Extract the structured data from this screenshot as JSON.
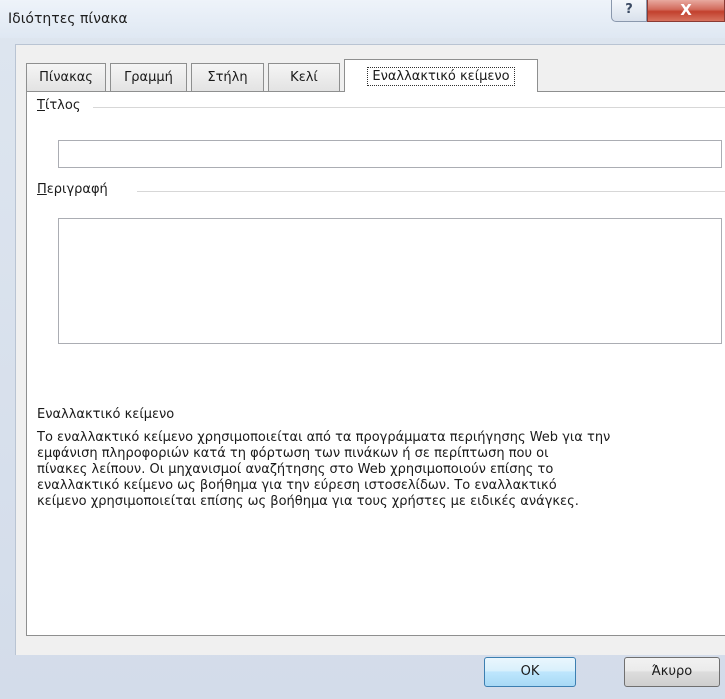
{
  "window": {
    "title": "Ιδιότητες πίνακα",
    "help_glyph": "?",
    "close_glyph": "X"
  },
  "tabs": [
    {
      "label": "Πίνακας"
    },
    {
      "label": "Γραμμή"
    },
    {
      "label": "Στήλη"
    },
    {
      "label": "Κελί"
    },
    {
      "label": "Εναλλακτικό κείμενο",
      "active": true
    }
  ],
  "form": {
    "title_label": "Τίτλος",
    "title_value": "",
    "description_label": "Περιγραφή",
    "description_value": ""
  },
  "help": {
    "heading": "Εναλλακτικό κείμενο",
    "lines": [
      "Το εναλλακτικό κείμενο χρησιμοποιείται από τα προγράμματα περιήγησης Web για την",
      "εμφάνιση πληροφοριών κατά τη φόρτωση των πινάκων ή σε περίπτωση που οι",
      "πίνακες λείπουν.  Οι μηχανισμοί αναζήτησης στο Web χρησιμοποιούν επίσης το",
      "εναλλακτικό κείμενο ως βοήθημα για την εύρεση ιστοσελίδων. Το εναλλακτικό",
      "κείμενο χρησιμοποιείται επίσης ως βοήθημα για τους χρήστες με ειδικές ανάγκες."
    ]
  },
  "buttons": {
    "ok": "OK",
    "cancel": "Άκυρο"
  }
}
